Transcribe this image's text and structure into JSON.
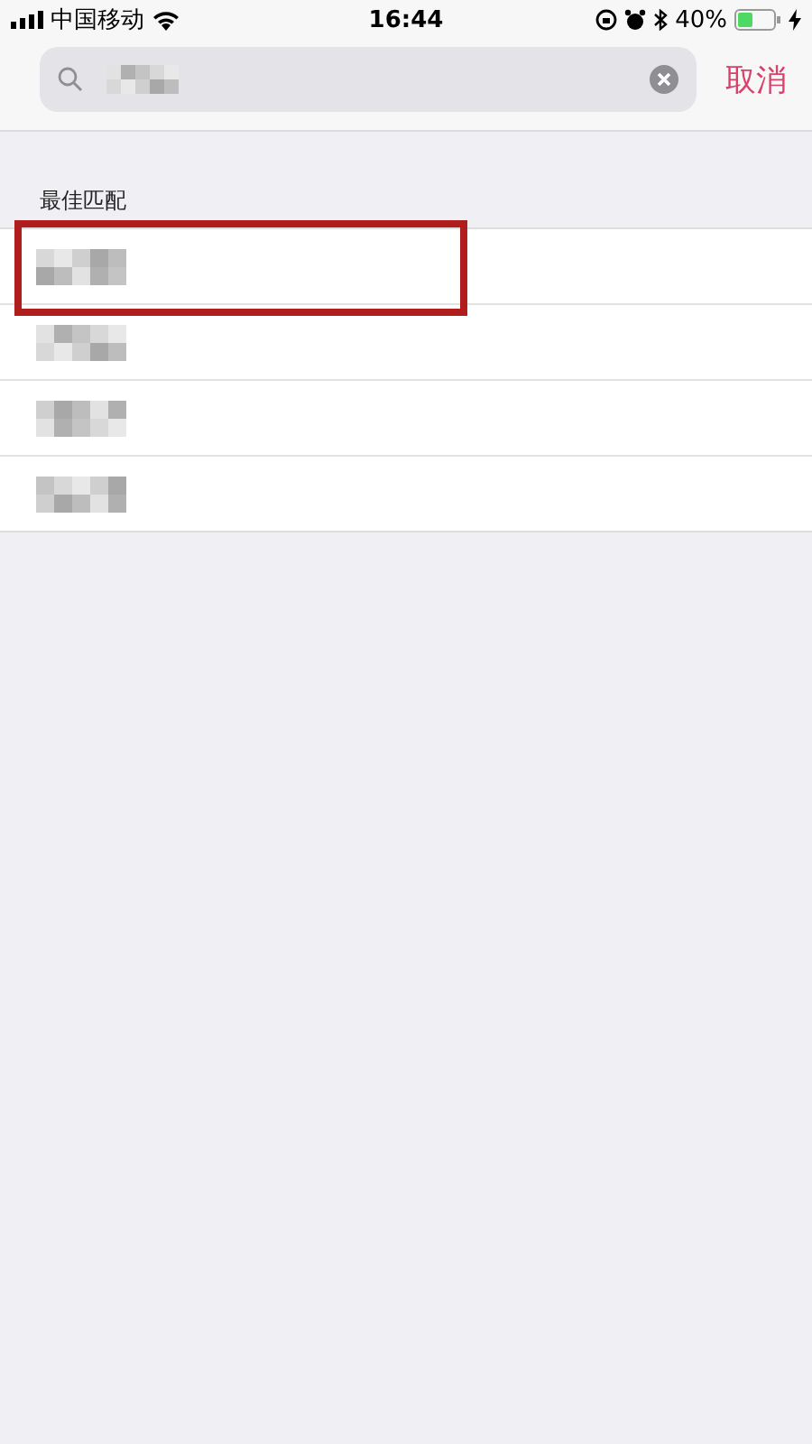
{
  "status_bar": {
    "carrier": "中国移动",
    "time": "16:44",
    "battery": "40%"
  },
  "search": {
    "cancel": "取消"
  },
  "section_title": "最佳匹配",
  "results": [
    {
      "highlighted": true
    },
    {
      "highlighted": false
    },
    {
      "highlighted": false
    },
    {
      "highlighted": false
    }
  ]
}
